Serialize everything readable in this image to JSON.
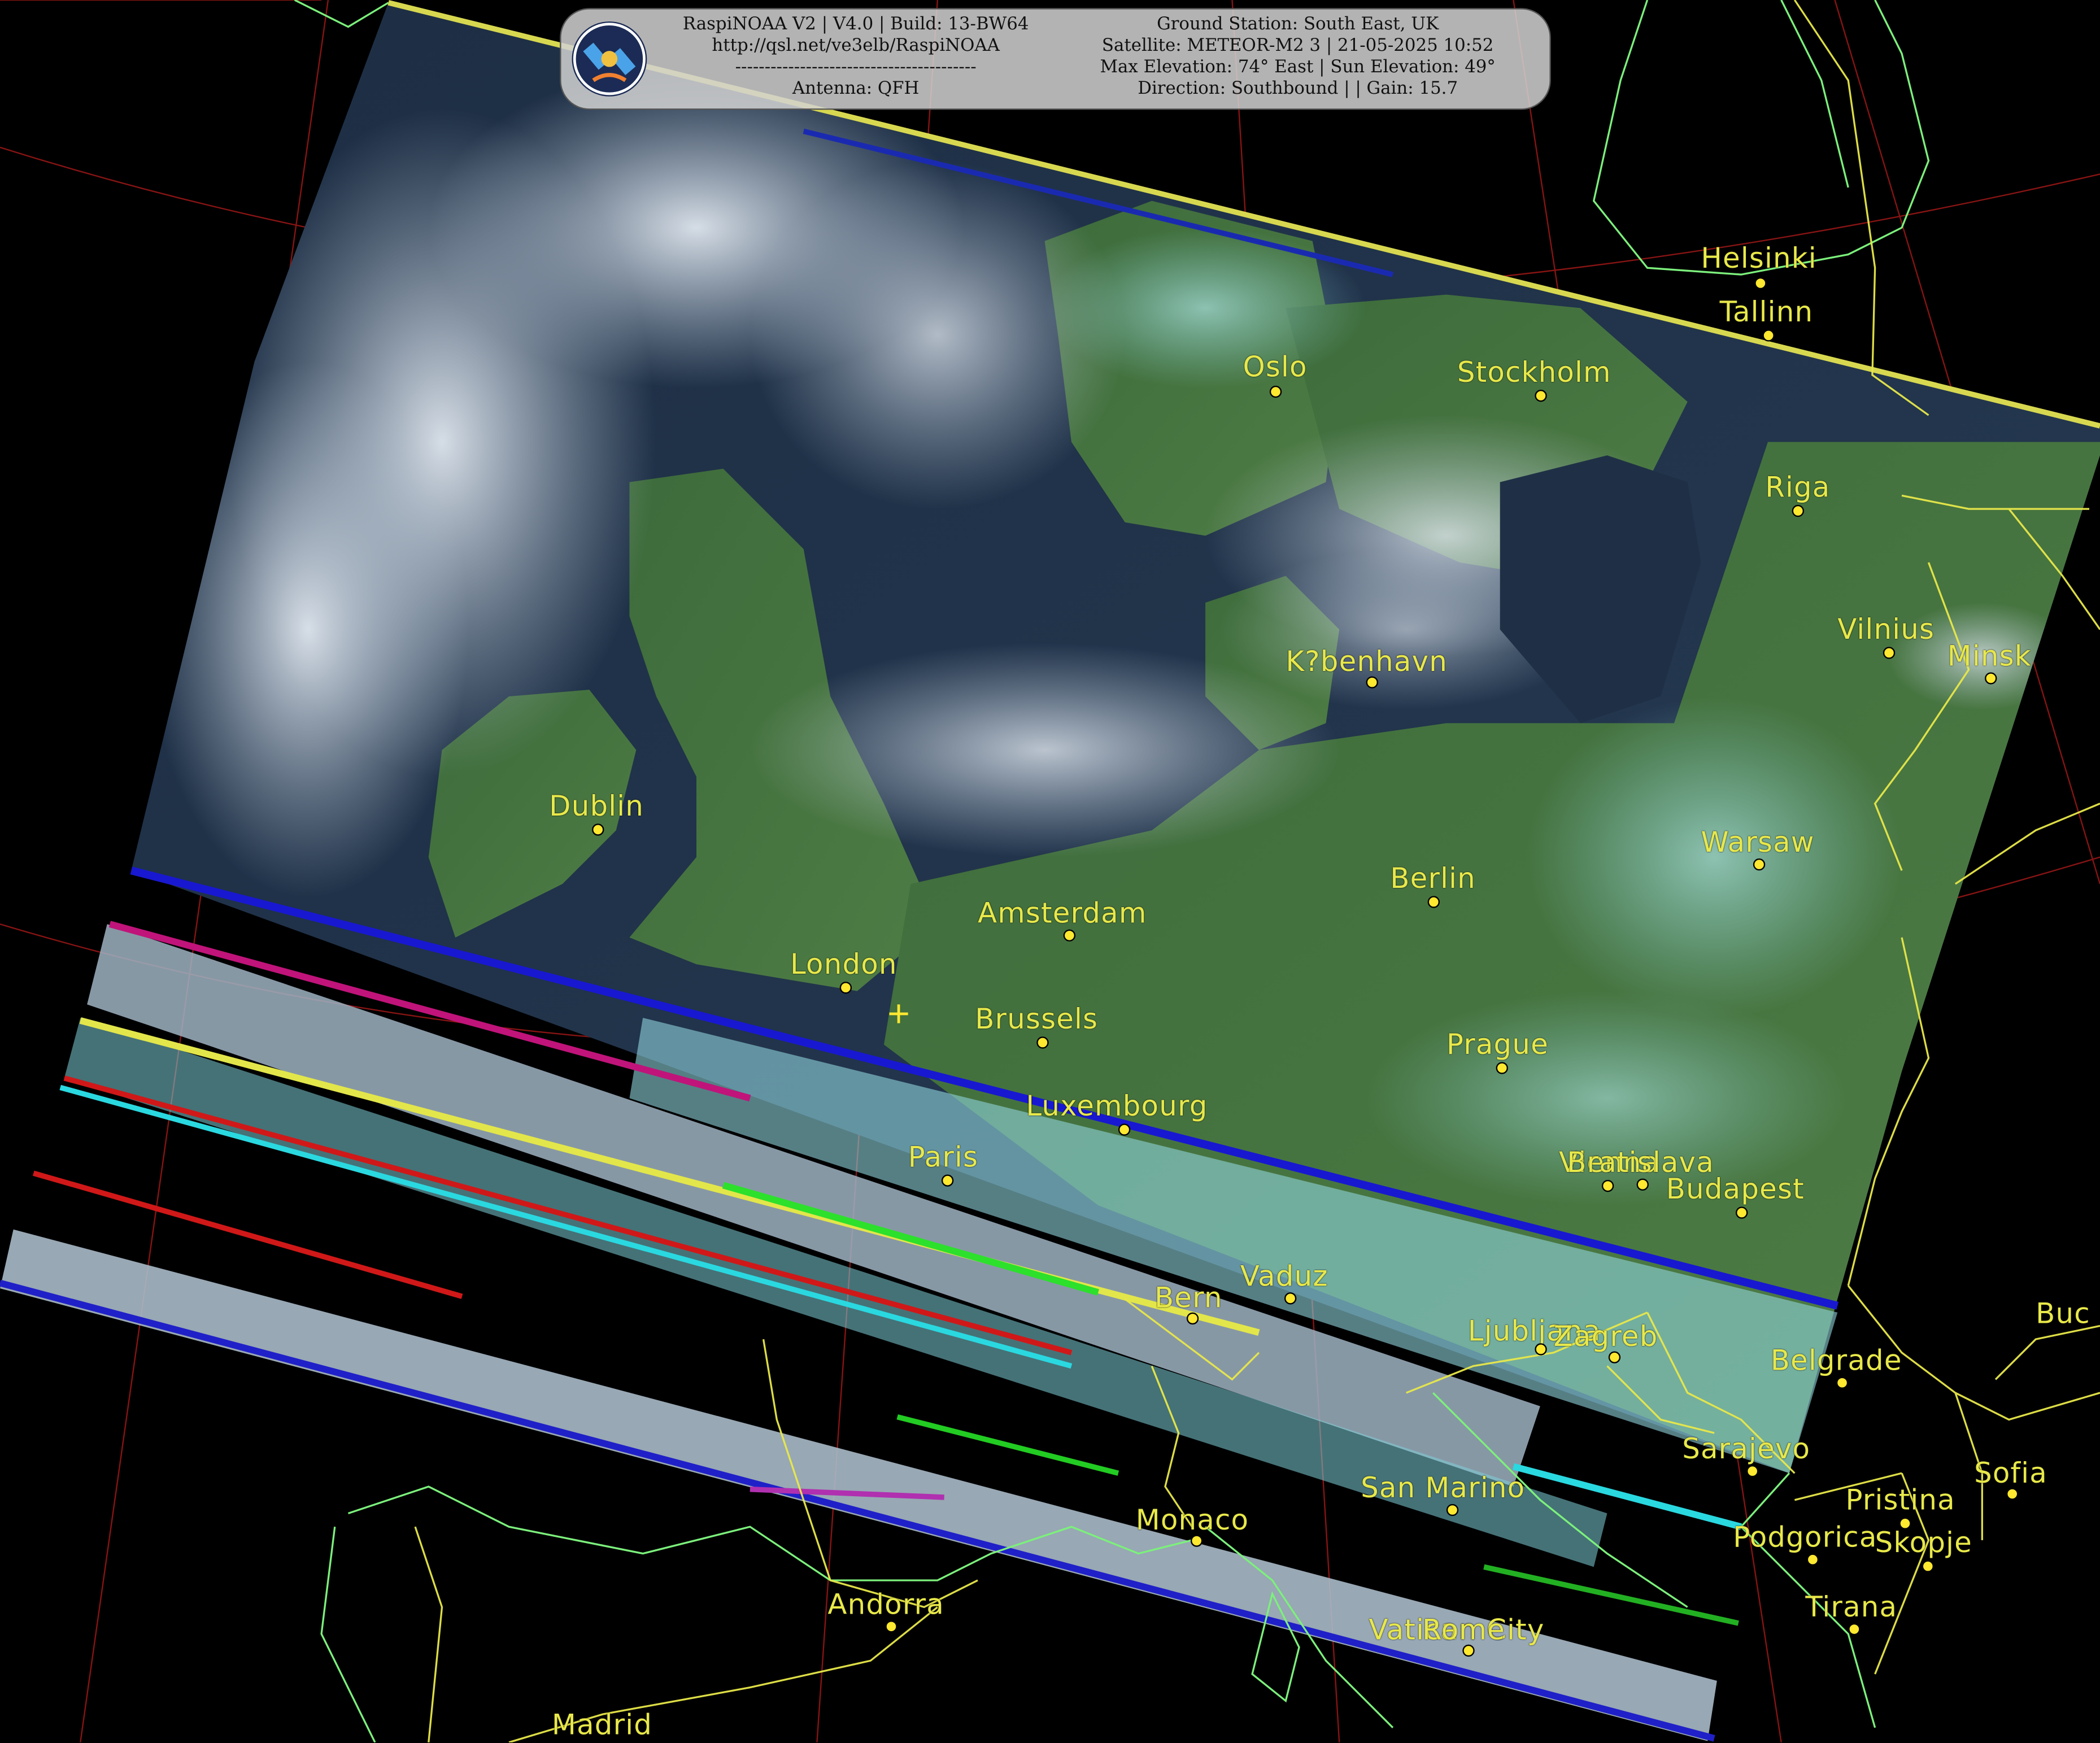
{
  "header": {
    "left_lines": [
      "RaspiNOAA V2 | V4.0 | Build: 13-BW64",
      "http://qsl.net/ve3elb/RaspiNOAA",
      "-----------------------------------------",
      "Antenna: QFH"
    ],
    "right_lines": [
      "Ground Station: South East, UK",
      "Satellite: METEOR-M2 3 | 21-05-2025 10:52",
      "Max Elevation: 74° East | Sun Elevation: 49°",
      "Direction: Southbound | | Gain: 15.7"
    ],
    "logo_icon": "satellite-logo-icon"
  },
  "cities": [
    {
      "name": "Helsinki"
    },
    {
      "name": "Tallinn"
    },
    {
      "name": "Oslo"
    },
    {
      "name": "Stockholm"
    },
    {
      "name": "Riga"
    },
    {
      "name": "Vilnius"
    },
    {
      "name": "Minsk"
    },
    {
      "name": "K?benhavn"
    },
    {
      "name": "Dublin"
    },
    {
      "name": "Warsaw"
    },
    {
      "name": "Berlin"
    },
    {
      "name": "Amsterdam"
    },
    {
      "name": "London"
    },
    {
      "name": "Brussels"
    },
    {
      "name": "Prague"
    },
    {
      "name": "Luxembourg"
    },
    {
      "name": "Paris"
    },
    {
      "name": "Vienna"
    },
    {
      "name": "Bratislava"
    },
    {
      "name": "Budapest"
    },
    {
      "name": "Bern"
    },
    {
      "name": "Vaduz"
    },
    {
      "name": "Ljubljana"
    },
    {
      "name": "Zagreb"
    },
    {
      "name": "Belgrade"
    },
    {
      "name": "Sarajevo"
    },
    {
      "name": "San Marino"
    },
    {
      "name": "Sofia"
    },
    {
      "name": "Pristina"
    },
    {
      "name": "Monaco"
    },
    {
      "name": "Podgorica"
    },
    {
      "name": "Skopje"
    },
    {
      "name": "Andorra"
    },
    {
      "name": "Tirana"
    },
    {
      "name": "Vatican City"
    },
    {
      "name": "Rome"
    },
    {
      "name": "Madrid"
    },
    {
      "name": "Buc"
    }
  ],
  "colors": {
    "label": "#e8e84a",
    "coastline": "#7cf07c",
    "border": "#e8e84a",
    "graticule": "#b02020"
  }
}
